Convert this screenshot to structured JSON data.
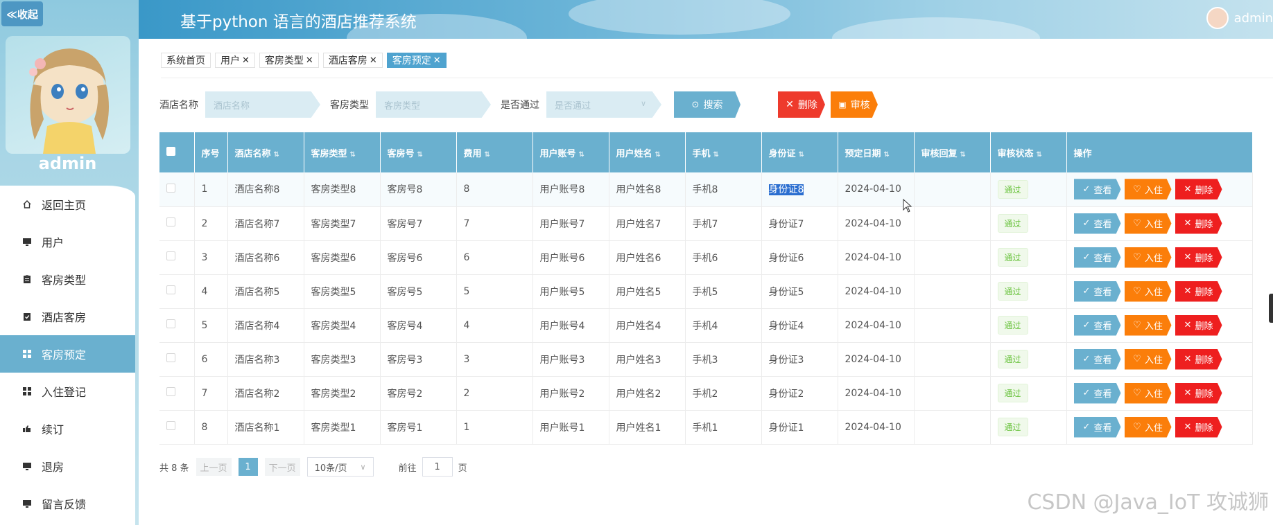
{
  "app": {
    "title": "基于python 语言的酒店推荐系统",
    "collapse_label": "≪收起"
  },
  "header": {
    "username": "admin"
  },
  "sidebar": {
    "username": "admin",
    "items": [
      {
        "label": "返回主页",
        "icon": "home-icon"
      },
      {
        "label": "用户",
        "icon": "monitor-icon"
      },
      {
        "label": "客房类型",
        "icon": "clipboard-icon"
      },
      {
        "label": "酒店客房",
        "icon": "clipboard-check-icon"
      },
      {
        "label": "客房预定",
        "icon": "grid-icon",
        "active": true
      },
      {
        "label": "入住登记",
        "icon": "grid-icon"
      },
      {
        "label": "续订",
        "icon": "hand-icon"
      },
      {
        "label": "退房",
        "icon": "monitor-icon"
      },
      {
        "label": "留言反馈",
        "icon": "monitor-icon"
      }
    ]
  },
  "tabs": [
    {
      "label": "系统首页",
      "closable": false
    },
    {
      "label": "用户",
      "closable": true
    },
    {
      "label": "客房类型",
      "closable": true
    },
    {
      "label": "酒店客房",
      "closable": true
    },
    {
      "label": "客房预定",
      "closable": true,
      "active": true
    }
  ],
  "search": {
    "hotel_label": "酒店名称",
    "hotel_placeholder": "酒店名称",
    "room_type_label": "客房类型",
    "room_type_placeholder": "客房类型",
    "passed_label": "是否通过",
    "passed_placeholder": "是否通过",
    "search_btn": "搜索",
    "delete_btn": "删除",
    "audit_btn": "审核"
  },
  "table": {
    "columns": [
      "序号",
      "酒店名称",
      "客房类型",
      "客房号",
      "费用",
      "用户账号",
      "用户姓名",
      "手机",
      "身份证",
      "预定日期",
      "审核回复",
      "审核状态",
      "操作"
    ],
    "rows": [
      {
        "no": "1",
        "hotel": "酒店名称8",
        "type": "客房类型8",
        "room": "客房号8",
        "fee": "8",
        "account": "用户账号8",
        "name": "用户姓名8",
        "phone": "手机8",
        "id": "身份证8",
        "date": "2024-04-10",
        "reply": "",
        "status": "通过"
      },
      {
        "no": "2",
        "hotel": "酒店名称7",
        "type": "客房类型7",
        "room": "客房号7",
        "fee": "7",
        "account": "用户账号7",
        "name": "用户姓名7",
        "phone": "手机7",
        "id": "身份证7",
        "date": "2024-04-10",
        "reply": "",
        "status": "通过"
      },
      {
        "no": "3",
        "hotel": "酒店名称6",
        "type": "客房类型6",
        "room": "客房号6",
        "fee": "6",
        "account": "用户账号6",
        "name": "用户姓名6",
        "phone": "手机6",
        "id": "身份证6",
        "date": "2024-04-10",
        "reply": "",
        "status": "通过"
      },
      {
        "no": "4",
        "hotel": "酒店名称5",
        "type": "客房类型5",
        "room": "客房号5",
        "fee": "5",
        "account": "用户账号5",
        "name": "用户姓名5",
        "phone": "手机5",
        "id": "身份证5",
        "date": "2024-04-10",
        "reply": "",
        "status": "通过"
      },
      {
        "no": "5",
        "hotel": "酒店名称4",
        "type": "客房类型4",
        "room": "客房号4",
        "fee": "4",
        "account": "用户账号4",
        "name": "用户姓名4",
        "phone": "手机4",
        "id": "身份证4",
        "date": "2024-04-10",
        "reply": "",
        "status": "通过"
      },
      {
        "no": "6",
        "hotel": "酒店名称3",
        "type": "客房类型3",
        "room": "客房号3",
        "fee": "3",
        "account": "用户账号3",
        "name": "用户姓名3",
        "phone": "手机3",
        "id": "身份证3",
        "date": "2024-04-10",
        "reply": "",
        "status": "通过"
      },
      {
        "no": "7",
        "hotel": "酒店名称2",
        "type": "客房类型2",
        "room": "客房号2",
        "fee": "2",
        "account": "用户账号2",
        "name": "用户姓名2",
        "phone": "手机2",
        "id": "身份证2",
        "date": "2024-04-10",
        "reply": "",
        "status": "通过"
      },
      {
        "no": "8",
        "hotel": "酒店名称1",
        "type": "客房类型1",
        "room": "客房号1",
        "fee": "1",
        "account": "用户账号1",
        "name": "用户姓名1",
        "phone": "手机1",
        "id": "身份证1",
        "date": "2024-04-10",
        "reply": "",
        "status": "通过"
      }
    ],
    "actions": {
      "view": "查看",
      "checkin": "入住",
      "delete": "删除"
    }
  },
  "pager": {
    "total": "共 8 条",
    "prev": "上一页",
    "current": "1",
    "next": "下一页",
    "page_size": "10条/页",
    "goto_label": "前往",
    "goto_value": "1",
    "page_suffix": "页"
  },
  "watermark": "CSDN @Java_IoT 攻诚狮",
  "colors": {
    "primary": "#6ab0cf",
    "danger": "#ee1f1f",
    "warning": "#fb7e0a",
    "success": "#67c23a"
  }
}
